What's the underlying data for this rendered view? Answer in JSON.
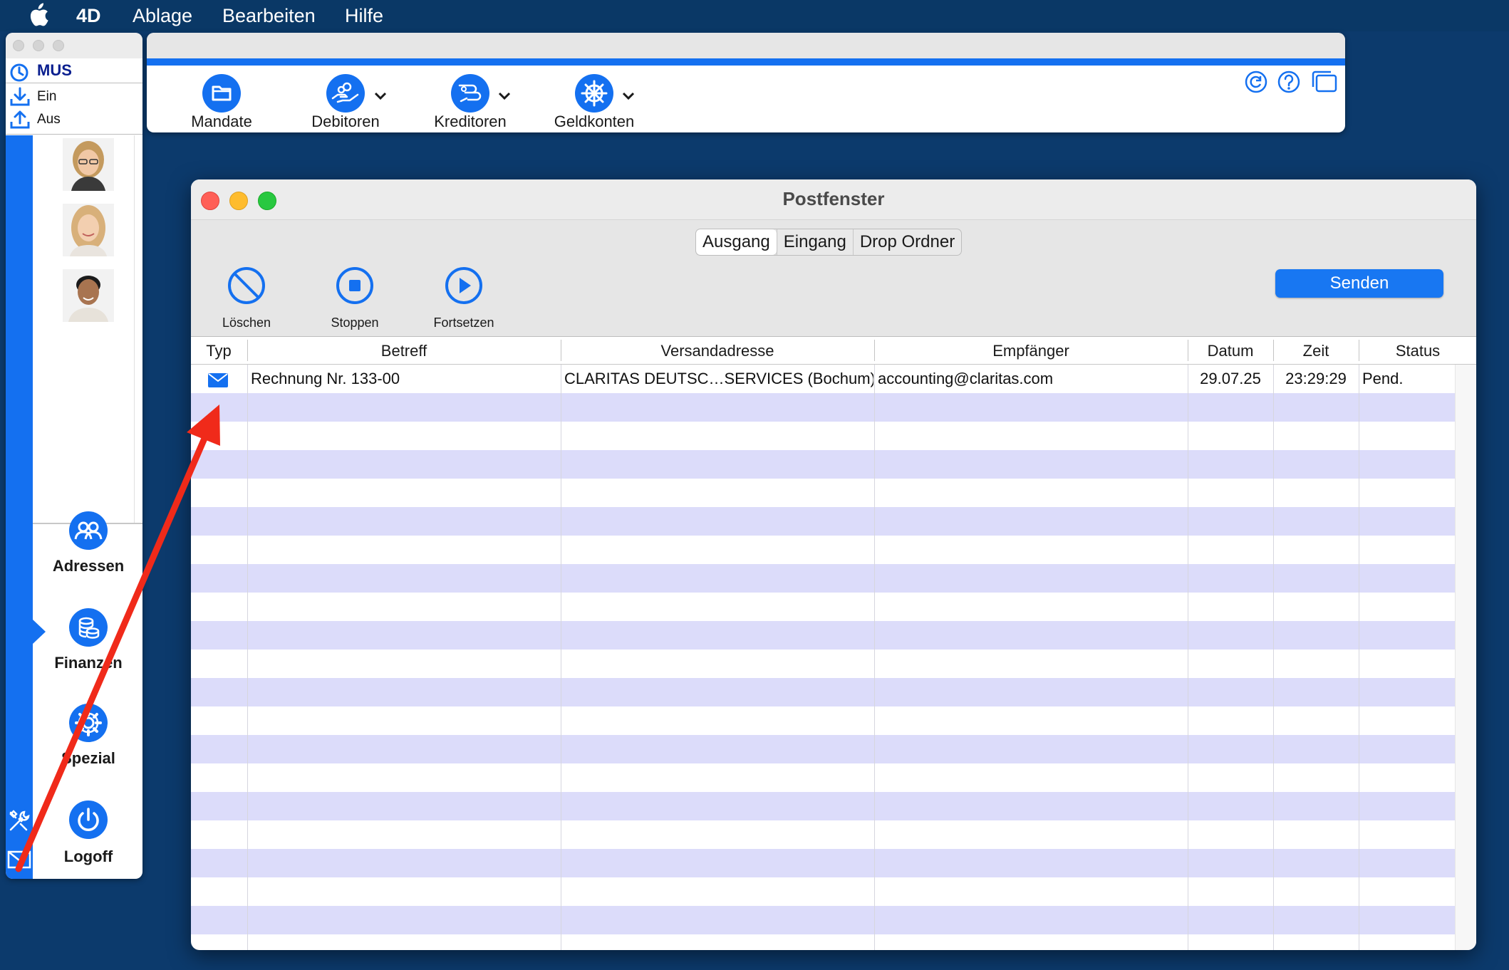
{
  "menubar": {
    "app": "4D",
    "items": [
      "Ablage",
      "Bearbeiten",
      "Hilfe"
    ]
  },
  "left_panel": {
    "title": "MUS",
    "in_label": "Ein",
    "out_label": "Aus",
    "nav": [
      {
        "label": "Adressen",
        "icon": "people-icon"
      },
      {
        "label": "Finanzen",
        "icon": "coins-icon"
      },
      {
        "label": "Spezial",
        "icon": "gear-icon"
      },
      {
        "label": "Logoff",
        "icon": "power-icon"
      }
    ],
    "selected": "Finanzen"
  },
  "toolbar": {
    "items": [
      {
        "label": "Mandate",
        "icon": "folder-icon",
        "has_menu": false
      },
      {
        "label": "Debitoren",
        "icon": "hand-coins-icon",
        "has_menu": true
      },
      {
        "label": "Kreditoren",
        "icon": "hand-coins-outgoing-icon",
        "has_menu": true
      },
      {
        "label": "Geldkonten",
        "icon": "ship-wheel-icon",
        "has_menu": true
      }
    ],
    "right_icons": [
      "refresh-icon",
      "help-icon",
      "windows-icon"
    ]
  },
  "postfenster": {
    "title": "Postfenster",
    "tabs": [
      "Ausgang",
      "Eingang",
      "Drop Ordner"
    ],
    "active_tab": "Ausgang",
    "actions": [
      {
        "label": "Löschen",
        "icon": "prohibit-icon"
      },
      {
        "label": "Stoppen",
        "icon": "stop-icon"
      },
      {
        "label": "Fortsetzen",
        "icon": "play-icon"
      }
    ],
    "send_button": "Senden",
    "columns": [
      "Typ",
      "Betreff",
      "Versandadresse",
      "Empfänger",
      "Datum",
      "Zeit",
      "Status"
    ],
    "rows": [
      {
        "typ_icon": "envelope-icon",
        "betreff": "Rechnung Nr. 133-00",
        "versandadresse": "CLARITAS DEUTSC…SERVICES (Bochum)",
        "empfaenger": "accounting@claritas.com",
        "datum": "29.07.25",
        "zeit": "23:29:29",
        "status": "Pend."
      }
    ]
  },
  "colors": {
    "desktop": "#0c3a6c",
    "accent": "#1470f0",
    "row_alt": "#dcdcfa",
    "arrow": "#f02a1a"
  }
}
